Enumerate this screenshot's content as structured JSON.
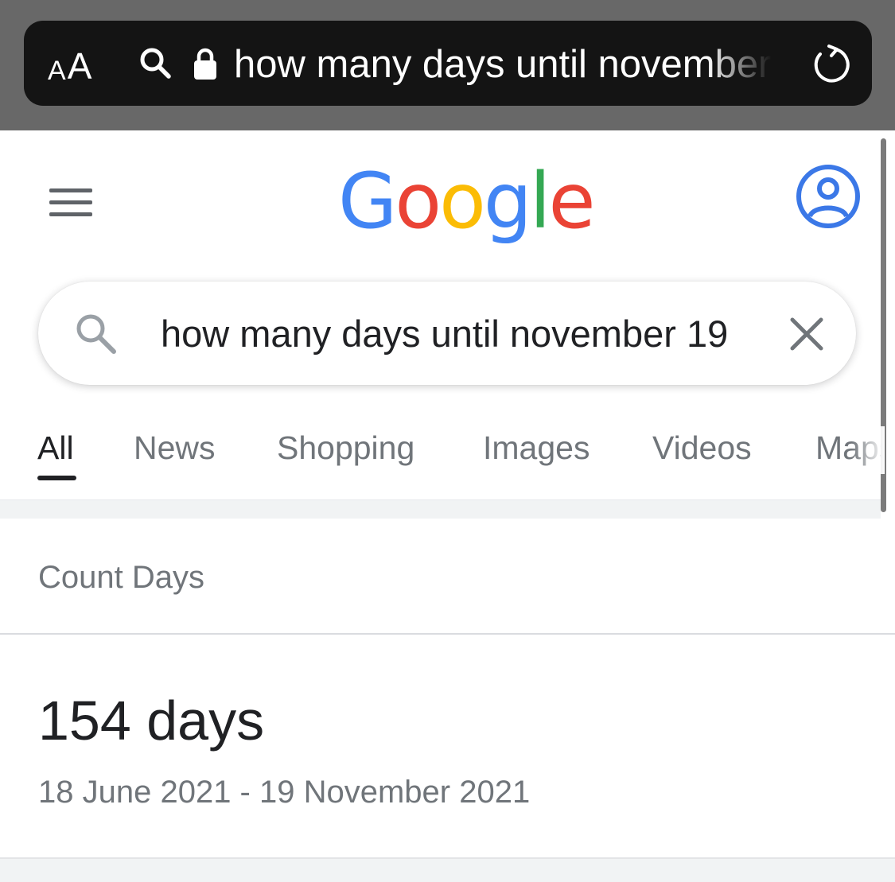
{
  "browser": {
    "text_size_button": {
      "small": "A",
      "large": "A"
    },
    "url_text": "how many days until november 19",
    "reload_icon": "reload-icon",
    "search_icon": "search-icon",
    "lock_icon": "lock-icon"
  },
  "header": {
    "menu_icon": "hamburger-menu-icon",
    "logo": [
      {
        "char": "G",
        "color": "#4285F4"
      },
      {
        "char": "o",
        "color": "#EA4335"
      },
      {
        "char": "o",
        "color": "#FBBC05"
      },
      {
        "char": "g",
        "color": "#4285F4"
      },
      {
        "char": "l",
        "color": "#34A853"
      },
      {
        "char": "e",
        "color": "#EA4335"
      }
    ],
    "account_icon": "account-circle-icon",
    "account_color": "#3b78e7"
  },
  "search": {
    "query": "how many days until november 19",
    "search_icon": "search-icon",
    "clear_icon": "close-icon"
  },
  "tabs": [
    {
      "label": "All",
      "active": true
    },
    {
      "label": "News",
      "active": false
    },
    {
      "label": "Shopping",
      "active": false
    },
    {
      "label": "Images",
      "active": false
    },
    {
      "label": "Videos",
      "active": false
    },
    {
      "label": "Maps",
      "active": false
    }
  ],
  "result_card": {
    "title": "Count Days",
    "value": "154 days",
    "range": "18 June 2021 - 19 November 2021"
  }
}
